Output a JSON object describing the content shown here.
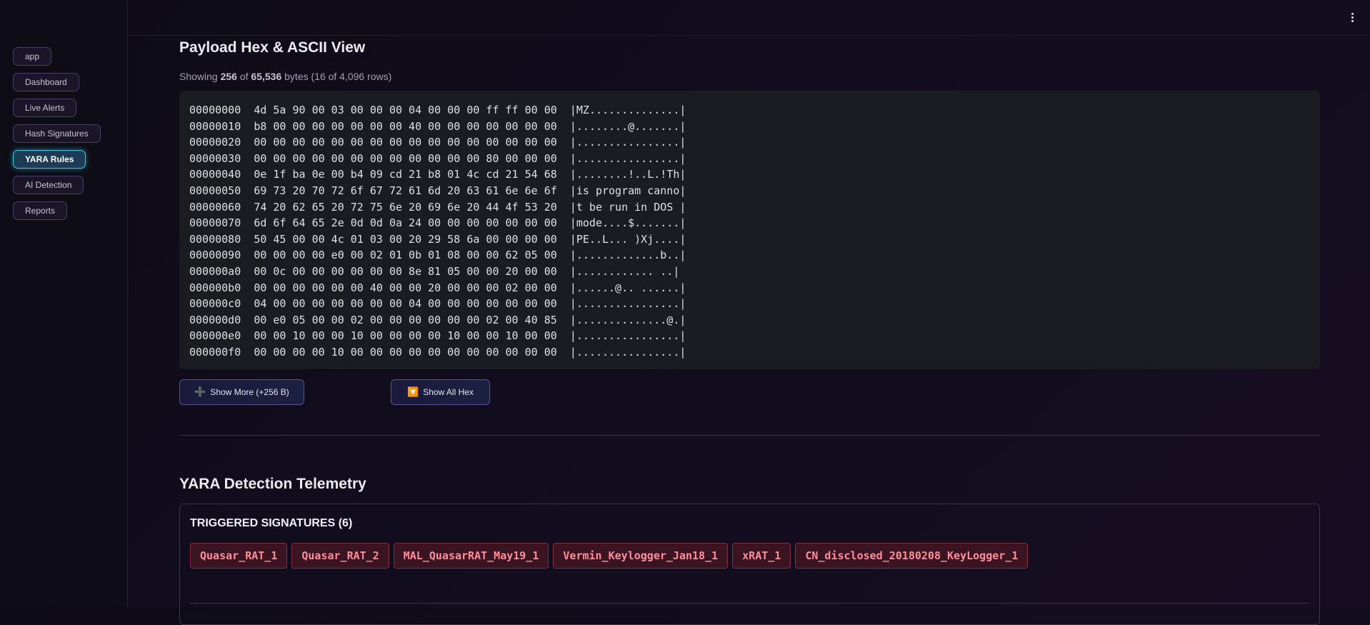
{
  "sidebar": {
    "items": [
      {
        "label": "app",
        "active": false
      },
      {
        "label": "Dashboard",
        "active": false
      },
      {
        "label": "Live Alerts",
        "active": false
      },
      {
        "label": "Hash Signatures",
        "active": false
      },
      {
        "label": "YARA Rules",
        "active": true
      },
      {
        "label": "AI Detection",
        "active": false
      },
      {
        "label": "Reports",
        "active": false
      }
    ]
  },
  "topbar": {
    "menu_icon": "vertical-ellipsis-icon"
  },
  "hex_view": {
    "title": "Payload Hex & ASCII View",
    "caption": {
      "prefix": "Showing ",
      "shown_bytes": "256",
      "middle": " of ",
      "total_bytes": "65,536",
      "suffix": " bytes (16 of 4,096 rows)"
    },
    "rows": [
      {
        "offset": "00000000",
        "hex": "4d 5a 90 00 03 00 00 00 04 00 00 00 ff ff 00 00",
        "ascii": "|MZ..............|"
      },
      {
        "offset": "00000010",
        "hex": "b8 00 00 00 00 00 00 00 40 00 00 00 00 00 00 00",
        "ascii": "|........@.......|"
      },
      {
        "offset": "00000020",
        "hex": "00 00 00 00 00 00 00 00 00 00 00 00 00 00 00 00",
        "ascii": "|................|"
      },
      {
        "offset": "00000030",
        "hex": "00 00 00 00 00 00 00 00 00 00 00 00 80 00 00 00",
        "ascii": "|................|"
      },
      {
        "offset": "00000040",
        "hex": "0e 1f ba 0e 00 b4 09 cd 21 b8 01 4c cd 21 54 68",
        "ascii": "|........!..L.!Th|"
      },
      {
        "offset": "00000050",
        "hex": "69 73 20 70 72 6f 67 72 61 6d 20 63 61 6e 6e 6f",
        "ascii": "|is program canno|"
      },
      {
        "offset": "00000060",
        "hex": "74 20 62 65 20 72 75 6e 20 69 6e 20 44 4f 53 20",
        "ascii": "|t be run in DOS |"
      },
      {
        "offset": "00000070",
        "hex": "6d 6f 64 65 2e 0d 0d 0a 24 00 00 00 00 00 00 00",
        "ascii": "|mode....$.......|"
      },
      {
        "offset": "00000080",
        "hex": "50 45 00 00 4c 01 03 00 20 29 58 6a 00 00 00 00",
        "ascii": "|PE..L... )Xj....|"
      },
      {
        "offset": "00000090",
        "hex": "00 00 00 00 e0 00 02 01 0b 01 08 00 00 62 05 00",
        "ascii": "|.............b..|"
      },
      {
        "offset": "000000a0",
        "hex": "00 0c 00 00 00 00 00 00 8e 81 05 00 00 20 00 00",
        "ascii": "|............ ..|"
      },
      {
        "offset": "000000b0",
        "hex": "00 00 00 00 00 00 40 00 00 20 00 00 00 02 00 00",
        "ascii": "|......@.. ......|"
      },
      {
        "offset": "000000c0",
        "hex": "04 00 00 00 00 00 00 00 04 00 00 00 00 00 00 00",
        "ascii": "|................|"
      },
      {
        "offset": "000000d0",
        "hex": "00 e0 05 00 00 02 00 00 00 00 00 00 02 00 40 85",
        "ascii": "|..............@.|"
      },
      {
        "offset": "000000e0",
        "hex": "00 00 10 00 00 10 00 00 00 00 10 00 00 10 00 00",
        "ascii": "|................|"
      },
      {
        "offset": "000000f0",
        "hex": "00 00 00 00 10 00 00 00 00 00 00 00 00 00 00 00",
        "ascii": "|................|"
      }
    ],
    "show_more": {
      "emoji": "➕",
      "label": "Show More (+256 B)"
    },
    "show_all": {
      "emoji": "🔽",
      "label": "Show All Hex"
    }
  },
  "telemetry": {
    "title": "YARA Detection Telemetry",
    "triggered_title": "TRIGGERED SIGNATURES (6)",
    "signatures": [
      "Quasar_RAT_1",
      "Quasar_RAT_2",
      "MAL_QuasarRAT_May19_1",
      "Vermin_Keylogger_Jan18_1",
      "xRAT_1",
      "CN_disclosed_20180208_KeyLogger_1"
    ]
  }
}
